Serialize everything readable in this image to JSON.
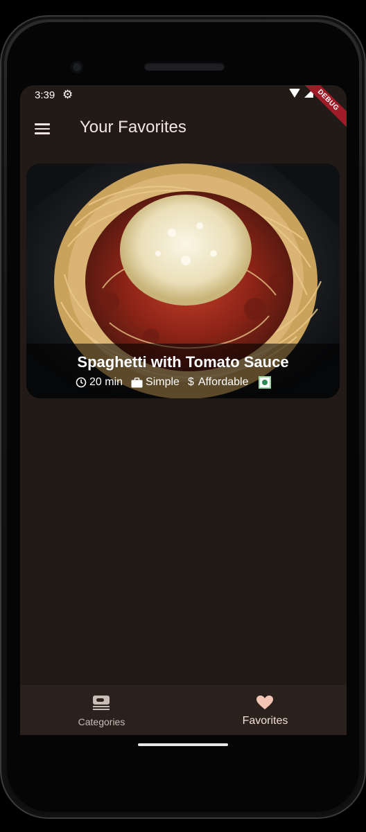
{
  "status_bar": {
    "time": "3:39",
    "debug_label": "DEBUG"
  },
  "app_bar": {
    "title": "Your Favorites",
    "menu_icon": "menu-icon"
  },
  "meal": {
    "title": "Spaghetti with Tomato Sauce",
    "duration": "20 min",
    "complexity": "Simple",
    "affordability": "Affordable",
    "icons": [
      "clock-icon",
      "briefcase-icon",
      "dollar-icon",
      "veg-icon"
    ]
  },
  "bottom_nav": {
    "items": [
      {
        "label": "Categories",
        "icon": "categories-icon",
        "selected": false
      },
      {
        "label": "Favorites",
        "icon": "heart-icon",
        "selected": true
      }
    ]
  },
  "colors": {
    "background": "#211a17",
    "accent": "#f3c5b5",
    "debug_banner": "#a01b28"
  }
}
